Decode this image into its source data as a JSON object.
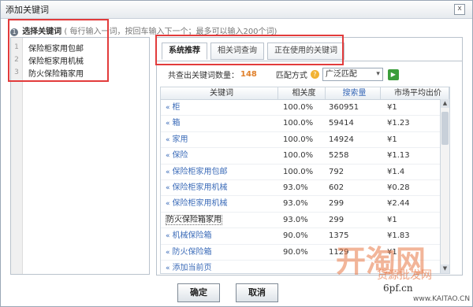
{
  "dialog": {
    "title": "添加关键词",
    "close_glyph": "x"
  },
  "instruction": {
    "step": "1",
    "label": "选择关键词",
    "hint": "( 每行输入一词，按回车输入下一个；最多可以输入200个词)"
  },
  "keyword_input": {
    "lines": [
      {
        "num": "1",
        "text": "保险柜家用包邮"
      },
      {
        "num": "2",
        "text": "保险柜家用机械"
      },
      {
        "num": "3",
        "text": "防火保险箱家用"
      }
    ]
  },
  "tabs": [
    {
      "label": "系统推荐",
      "active": true
    },
    {
      "label": "相关词查询",
      "active": false
    },
    {
      "label": "正在使用的关键词",
      "active": false
    }
  ],
  "stats": {
    "count_label": "共查出关键词数量：",
    "count": "148",
    "match_label": "匹配方式",
    "match_value": "广泛匹配",
    "help_glyph": "?"
  },
  "table": {
    "headers": [
      "关键词",
      "相关度",
      "搜索量",
      "市场平均出价"
    ],
    "rows": [
      {
        "keyword": "柜",
        "relevance": "100.0%",
        "volume": "360951",
        "price": "¥1"
      },
      {
        "keyword": "箱",
        "relevance": "100.0%",
        "volume": "59414",
        "price": "¥1.23"
      },
      {
        "keyword": "家用",
        "relevance": "100.0%",
        "volume": "14924",
        "price": "¥1"
      },
      {
        "keyword": "保险",
        "relevance": "100.0%",
        "volume": "5258",
        "price": "¥1.13"
      },
      {
        "keyword": "保险柜家用包邮",
        "relevance": "100.0%",
        "volume": "792",
        "price": "¥1.4"
      },
      {
        "keyword": "保险柜家用机械",
        "relevance": "93.0%",
        "volume": "602",
        "price": "¥0.28"
      },
      {
        "keyword": "保险柜家用机械",
        "relevance": "93.0%",
        "volume": "299",
        "price": "¥2.44"
      },
      {
        "keyword": "防火保险箱家用",
        "relevance": "93.0%",
        "volume": "299",
        "price": "¥1"
      },
      {
        "keyword": "机械保险箱",
        "relevance": "90.0%",
        "volume": "1375",
        "price": "¥1.83"
      },
      {
        "keyword": "防火保险箱",
        "relevance": "90.0%",
        "volume": "1129",
        "price": "¥1"
      },
      {
        "keyword": "添加当前页",
        "relevance": "",
        "volume": "",
        "price": ""
      }
    ]
  },
  "buttons": {
    "confirm": "确定",
    "cancel": "取消"
  },
  "watermark": {
    "big": "开淘网",
    "sub": "货源批发网",
    "domain": "6pf.cn",
    "domain2": "www.KAITAO.CN"
  },
  "colors": {
    "highlight_border": "#e23b3b",
    "link": "#3b6bb8",
    "count": "#e0802a"
  }
}
